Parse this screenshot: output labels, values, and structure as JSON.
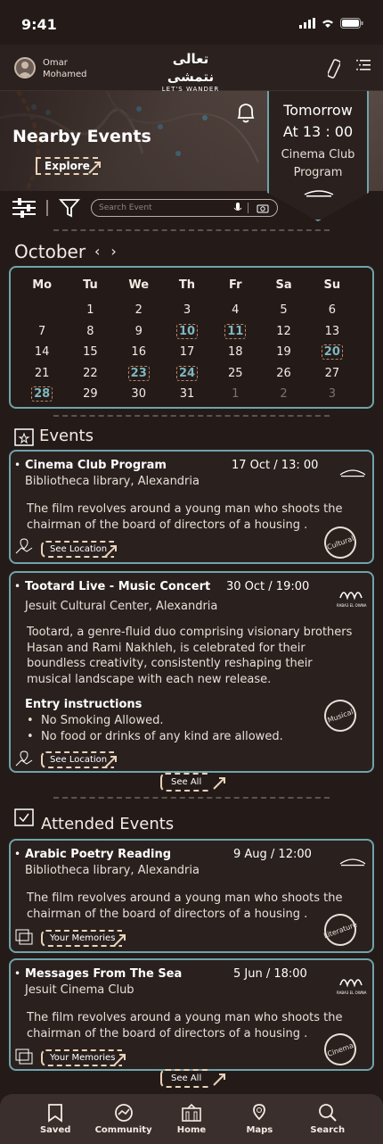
{
  "status": {
    "time": "9:41"
  },
  "user": {
    "name": "Omar Mohamed"
  },
  "logo": {
    "arabic": "تعالى نتمشى",
    "latin": "LET'S WANDER"
  },
  "hero": {
    "title": "Nearby Events",
    "explore": "Explore"
  },
  "next_event": {
    "line1": "Tomorrow",
    "line2": "At 13 : 00",
    "line3": "Cinema Club Program"
  },
  "search": {
    "placeholder": "Search Event"
  },
  "calendar": {
    "month": "October",
    "weekdays": [
      "Mo",
      "Tu",
      "We",
      "Th",
      "Fr",
      "Sa",
      "Su"
    ],
    "weeks": [
      [
        "",
        "1",
        "2",
        "3",
        "4",
        "5",
        "6"
      ],
      [
        "7",
        "8",
        "9",
        "10",
        "11",
        "12",
        "13"
      ],
      [
        "14",
        "15",
        "16",
        "17",
        "18",
        "19",
        "20"
      ],
      [
        "21",
        "22",
        "23",
        "24",
        "25",
        "26",
        "27"
      ],
      [
        "28",
        "29",
        "30",
        "31",
        "1",
        "2",
        "3"
      ]
    ],
    "highlighted": [
      "10",
      "11",
      "20",
      "23",
      "24",
      "28"
    ]
  },
  "events_section": {
    "title": "Events",
    "see_all": "See All"
  },
  "events": [
    {
      "title": "Cinema Club Program",
      "date": "17 Oct / 13: 00",
      "place": "Bibliotheca library, Alexandria",
      "desc": "The film revolves around a young man who shoots the chairman of the board of directors of a housing .",
      "action": "See Location",
      "tag": "Cultural"
    },
    {
      "title": "Tootard Live - Music Concert",
      "date": "30 Oct  / 19:00",
      "place": "Jesuit Cultural Center, Alexandria",
      "desc": "Tootard, a genre-fluid duo comprising visionary brothers Hasan and Rami Nakhleh, is celebrated for their boundless creativity, consistently reshaping their musical landscape with each new release.",
      "entry_title": "Entry instructions",
      "entry_items": [
        "No Smoking Allowed.",
        "No food or drinks of any kind are allowed."
      ],
      "action": "See Location",
      "tag": "Musical",
      "org": "RABA3 EL OWNA"
    }
  ],
  "attended_section": {
    "title": "Attended Events",
    "see_all": "See All"
  },
  "attended": [
    {
      "title": "Arabic Poetry Reading",
      "date": "9 Aug / 12:00",
      "place": "Bibliotheca library, Alexandria",
      "desc": "The film revolves around a young man who shoots the chairman of the board of directors of a housing .",
      "action": "Your Memories",
      "tag": "Literature"
    },
    {
      "title": "Messages From The Sea",
      "date": "5  Jun / 18:00",
      "place": "Jesuit Cinema Club",
      "desc": "The film revolves around a young man who shoots the chairman of the board of directors of a housing .",
      "action": "Your Memories",
      "tag": "Cinema",
      "org": "RABA3 EL OWNA"
    }
  ],
  "nav": {
    "saved": "Saved",
    "community": "Community",
    "home": "Home",
    "maps": "Maps",
    "search": "Search"
  },
  "colors": {
    "background": "#241b19",
    "accent": "#6fa3ab",
    "highlight": "#7fb6bf",
    "sand": "#e8d3b9"
  }
}
